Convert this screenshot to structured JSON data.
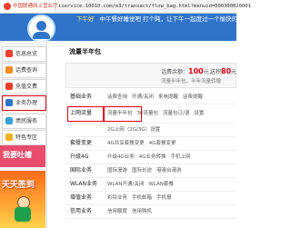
{
  "browser": {
    "tab_title": "中国联通网上营业厅",
    "url": "iservice.10010.com/e3/transact/flow_bag.html?menuid=000300020001"
  },
  "banner": {
    "greeting_time": "下午好",
    "greeting_text": "中午餐好睡觉吧  打个盹，让下午一起度过一个愉快的下午吧！"
  },
  "sidebar": {
    "items": [
      {
        "label": "信息总览",
        "icon": "info-icon",
        "color": "#e8402c"
      },
      {
        "label": "话费查询",
        "icon": "bill-icon",
        "color": "#f08a1c"
      },
      {
        "label": "充值交费",
        "icon": "recharge-icon",
        "color": "#e8402c"
      },
      {
        "label": "业务办理",
        "icon": "service-icon",
        "color": "#2f74c9"
      },
      {
        "label": "债民服务",
        "icon": "user-icon",
        "color": "#3aa0d8"
      },
      {
        "label": "特色专区",
        "icon": "star-icon",
        "color": "#f0b21c"
      }
    ],
    "active_index": 3,
    "promo1": "我要吐槽",
    "promo2": "天天签到"
  },
  "main": {
    "title": "流量半年包",
    "balance_label1": "话费余额：",
    "balance_value1": "100",
    "balance_unit1": "元，",
    "balance_label2": "送积",
    "balance_value2": "80",
    "balance_unit2": "元",
    "balance_note": "流量半年包，半年流量转赠"
  },
  "services": [
    {
      "category": "基础业务",
      "links": [
        "话费查询",
        "开通/关闭",
        "来电提醒",
        "话费提醒"
      ]
    },
    {
      "category": "上网流量",
      "links": [
        "流量半年包",
        "30流量包",
        "流量包订/退",
        "设置"
      ],
      "highlight": true
    },
    {
      "category": "",
      "links": [
        "2G上网（2G/3G）设置"
      ]
    },
    {
      "category": "套餐变更",
      "links": [
        "4G共享套餐变更",
        "4G套餐变更"
      ]
    },
    {
      "category": "升级4G",
      "links": [
        "升级4G业务",
        "4G业务转换",
        "手机上网"
      ]
    },
    {
      "category": "国际业务",
      "links": [
        "国际漫游",
        "国际长途",
        "港澳台漫游"
      ]
    },
    {
      "category": "WLAN业务",
      "links": [
        "WLAN开通/关闭",
        "WLAN套餐"
      ]
    },
    {
      "category": "增值业务",
      "links": [
        "彩铃业务",
        "手机邮箱",
        "手机报"
      ]
    },
    {
      "category": "信用业务",
      "links": [
        "信用额度",
        "信用购机"
      ]
    }
  ]
}
